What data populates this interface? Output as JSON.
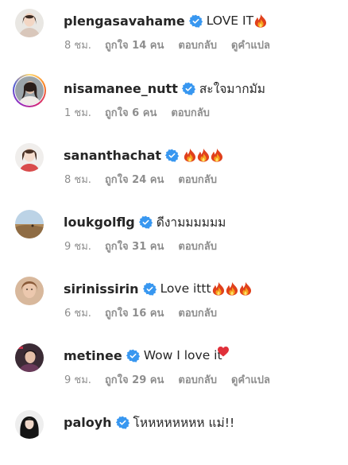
{
  "comments": [
    {
      "username": "plengasavahame",
      "text": "LOVE IT",
      "emoji_count": 1,
      "time": "8 ชม.",
      "likes": "ถูกใจ 14 คน",
      "reply": "ตอบกลับ",
      "translate": "ดูคำแปล"
    },
    {
      "username": "nisamanee_nutt",
      "text": "สะใจมากมัม",
      "time": "1 ชม.",
      "likes": "ถูกใจ 6 คน",
      "reply": "ตอบกลับ"
    },
    {
      "username": "sananthachat",
      "text": "",
      "emoji_count": 3,
      "time": "8 ชม.",
      "likes": "ถูกใจ 24 คน",
      "reply": "ตอบกลับ"
    },
    {
      "username": "loukgolflg",
      "text": "ดีงามมมมมม",
      "time": "9 ชม.",
      "likes": "ถูกใจ 31 คน",
      "reply": "ตอบกลับ"
    },
    {
      "username": "sirinissirin",
      "text": "Love ittt",
      "emoji_count": 3,
      "time": "6 ชม.",
      "likes": "ถูกใจ 16 คน",
      "reply": "ตอบกลับ"
    },
    {
      "username": "metinee",
      "text": "Wow I love it",
      "time": "9 ชม.",
      "likes": "ถูกใจ 29 คน",
      "reply": "ตอบกลับ",
      "translate": "ดูคำแปล"
    },
    {
      "username": "paloyh",
      "text": "โหหหหหหหห แม่!!"
    }
  ],
  "icons": {
    "verified": "verified-badge-icon",
    "fire": "fire-emoji-icon",
    "heart": "heart-emoji-icon"
  },
  "colors": {
    "verified_blue": "#3897f0",
    "meta_gray": "#8e8e8e",
    "text_dark": "#262626"
  }
}
